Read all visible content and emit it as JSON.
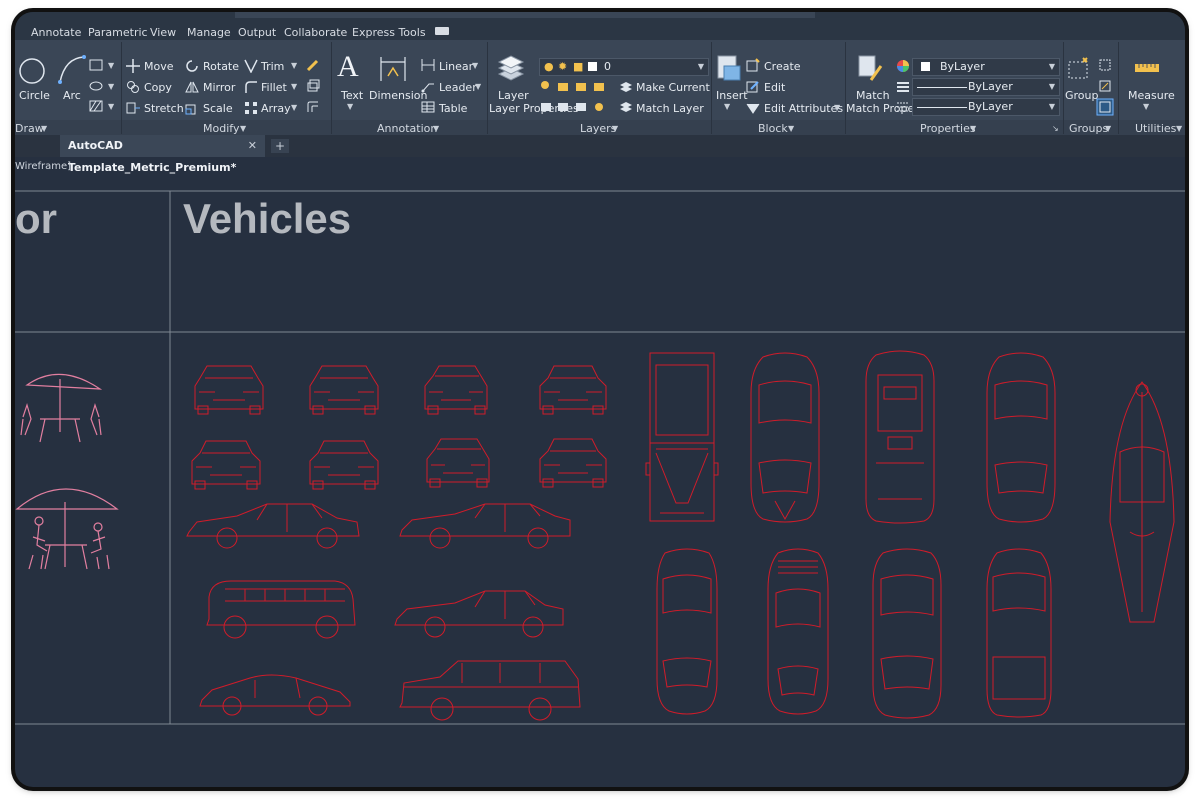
{
  "menubar": {
    "items": [
      "Annotate",
      "Parametric",
      "View",
      "Manage",
      "Output",
      "Collaborate",
      "Express Tools"
    ]
  },
  "ribbon": {
    "draw": {
      "circle": "Circle",
      "arc": "Arc",
      "title": "Draw"
    },
    "modify": {
      "move": "Move",
      "copy": "Copy",
      "stretch": "Stretch",
      "rotate": "Rotate",
      "mirror": "Mirror",
      "scale": "Scale",
      "trim": "Trim",
      "fillet": "Fillet",
      "array": "Array",
      "title": "Modify"
    },
    "annotation": {
      "text": "Text",
      "dimension": "Dimension",
      "linear": "Linear",
      "leader": "Leader",
      "table": "Table",
      "title": "Annotation"
    },
    "layers": {
      "layer_properties": "Layer Properties",
      "current_layer": "0",
      "make_current": "Make Current",
      "match_layer": "Match Layer",
      "title": "Layers"
    },
    "block": {
      "insert": "Insert",
      "create": "Create",
      "edit": "Edit",
      "edit_attributes": "Edit Attributes",
      "title": "Block"
    },
    "properties": {
      "match_properties": "Match Properties",
      "color": "ByLayer",
      "lineweight": "ByLayer",
      "linetype": "ByLayer",
      "title": "Properties"
    },
    "groups": {
      "group": "Group",
      "title": "Groups"
    },
    "utilities": {
      "measure": "Measure",
      "title": "Utilities"
    }
  },
  "tabs": {
    "active": "AutoCAD Template_Metric_Premium*",
    "close": "✕",
    "add": "+"
  },
  "viewport": {
    "label": "Wireframe]"
  },
  "drawing": {
    "title_left": "or",
    "title_main": "Vehicles"
  },
  "colors": {
    "accent_red": "#d01c2a",
    "pink": "#e27fa0",
    "bg": "#263040",
    "ribbon": "#3a4656"
  }
}
